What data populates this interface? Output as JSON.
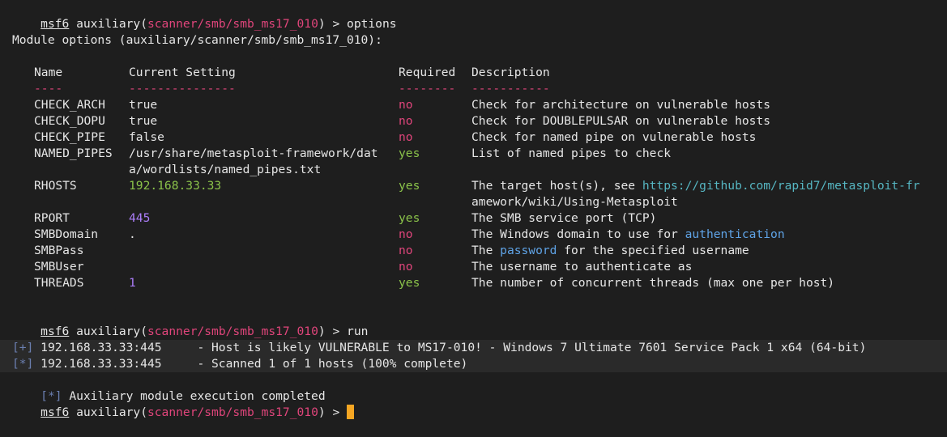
{
  "prompt": {
    "exe": "msf6",
    "word": "auxiliary",
    "module": "scanner/smb/smb_ms17_010",
    "caret": ">"
  },
  "cmd1": "options",
  "cmd2": "run",
  "module_options_heading": "Module options (auxiliary/scanner/smb/smb_ms17_010):",
  "table": {
    "headers": [
      "Name",
      "Current Setting",
      "Required",
      "Description"
    ],
    "underlines": [
      "----",
      "---------------",
      "--------",
      "-----------"
    ],
    "rows": [
      {
        "name": "CHECK_ARCH",
        "setting": "true",
        "required": "no",
        "desc": "Check for architecture on vulnerable hosts"
      },
      {
        "name": "CHECK_DOPU",
        "setting": "true",
        "required": "no",
        "desc": "Check for DOUBLEPULSAR on vulnerable hosts"
      },
      {
        "name": "CHECK_PIPE",
        "setting": "false",
        "required": "no",
        "desc": "Check for named pipe on vulnerable hosts"
      },
      {
        "name": "NAMED_PIPES",
        "setting": "/usr/share/metasploit-framework/dat",
        "setting2": "a/wordlists/named_pipes.txt",
        "required": "yes",
        "desc": "List of named pipes to check"
      },
      {
        "name": "RHOSTS",
        "setting": "192.168.33.33",
        "required": "yes",
        "desc_pre": "The target host(s), see ",
        "desc_link": "https://github.com/rapid7/metasploit-fr",
        "desc2": "amework/wiki/Using-Metasploit"
      },
      {
        "name": "RPORT",
        "setting": "445",
        "required": "yes",
        "desc": "The SMB service port (TCP)"
      },
      {
        "name": "SMBDomain",
        "setting": ".",
        "required": "no",
        "desc_pre": "The Windows domain to use for ",
        "desc_kw": "authentication"
      },
      {
        "name": "SMBPass",
        "setting": "",
        "required": "no",
        "desc_pre": "The ",
        "desc_kw": "password",
        "desc_post": " for the specified username"
      },
      {
        "name": "SMBUser",
        "setting": "",
        "required": "no",
        "desc": "The username to authenticate as"
      },
      {
        "name": "THREADS",
        "setting": "1",
        "required": "yes",
        "desc": "The number of concurrent threads (max one per host)"
      }
    ]
  },
  "output": [
    {
      "mark": "[+]",
      "text": "192.168.33.33:445     - Host is likely VULNERABLE to MS17-010! - Windows 7 Ultimate 7601 Service Pack 1 x64 (64-bit)"
    },
    {
      "mark": "[*]",
      "text": "192.168.33.33:445     - Scanned 1 of 1 hosts (100% complete)"
    },
    {
      "mark": "[*]",
      "text": "Auxiliary module execution completed"
    }
  ]
}
